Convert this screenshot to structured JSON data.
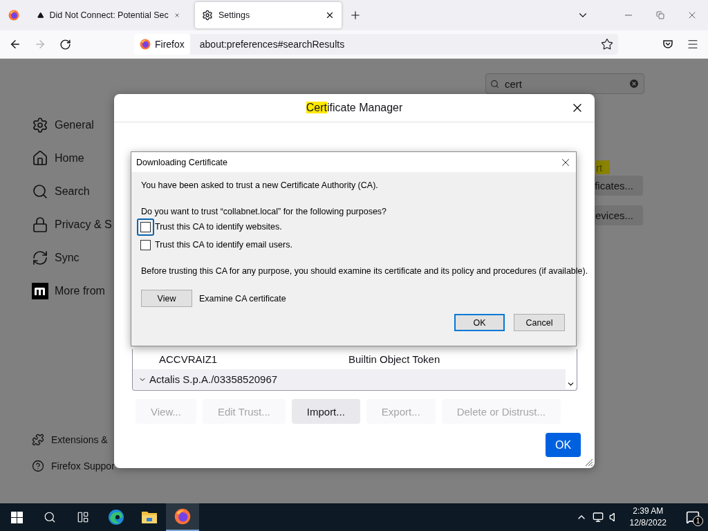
{
  "browser": {
    "tabs": [
      {
        "title": "Did Not Connect: Potential Sec",
        "selected": false
      },
      {
        "title": "Settings",
        "selected": true
      }
    ],
    "nav": {
      "forward_disabled": true,
      "identity": "Firefox",
      "url": "about:preferences#searchResults"
    }
  },
  "settings": {
    "search": {
      "value": "cert"
    },
    "sidebar": [
      "General",
      "Home",
      "Search",
      "Privacy & S",
      "Sync",
      "More from"
    ],
    "footer": [
      "Extensions &",
      "Firefox Suppor"
    ],
    "highlight": "rt",
    "buttons": [
      "ficates...",
      "evices..."
    ]
  },
  "certificate_manager": {
    "title_highlight": "Cert",
    "title_rest": "ificate Manager",
    "rows": [
      {
        "kind": "cert",
        "name": "ACCVRAIZ1",
        "device": "Builtin Object Token"
      },
      {
        "kind": "group",
        "name": "Actalis S.p.A./03358520967",
        "expanded": true
      }
    ],
    "actions": [
      {
        "label": "View...",
        "disabled": true
      },
      {
        "label": "Edit Trust...",
        "disabled": true
      },
      {
        "label": "Import...",
        "disabled": false
      },
      {
        "label": "Export...",
        "disabled": true
      },
      {
        "label": "Delete or Distrust...",
        "disabled": true
      }
    ],
    "ok": "OK"
  },
  "download_dialog": {
    "title": "Downloading Certificate",
    "intro": "You have been asked to trust a new Certificate Authority (CA).",
    "question": "Do you want to trust “collabnet.local” for the following purposes?",
    "options": [
      {
        "label": "Trust this CA to identify websites.",
        "checked": false,
        "focused": true
      },
      {
        "label": "Trust this CA to identify email users.",
        "checked": false,
        "focused": false
      }
    ],
    "advice": "Before trusting this CA for any purpose, you should examine its certificate and its policy and procedures (if available).",
    "view_button": "View",
    "view_label": "Examine CA certificate",
    "ok": "OK",
    "cancel": "Cancel"
  },
  "taskbar": {
    "apps": [
      {
        "active": false
      },
      {
        "active": false
      },
      {
        "active": true
      }
    ],
    "time": "2:39 AM",
    "date": "12/8/2022",
    "notifications": "1"
  }
}
